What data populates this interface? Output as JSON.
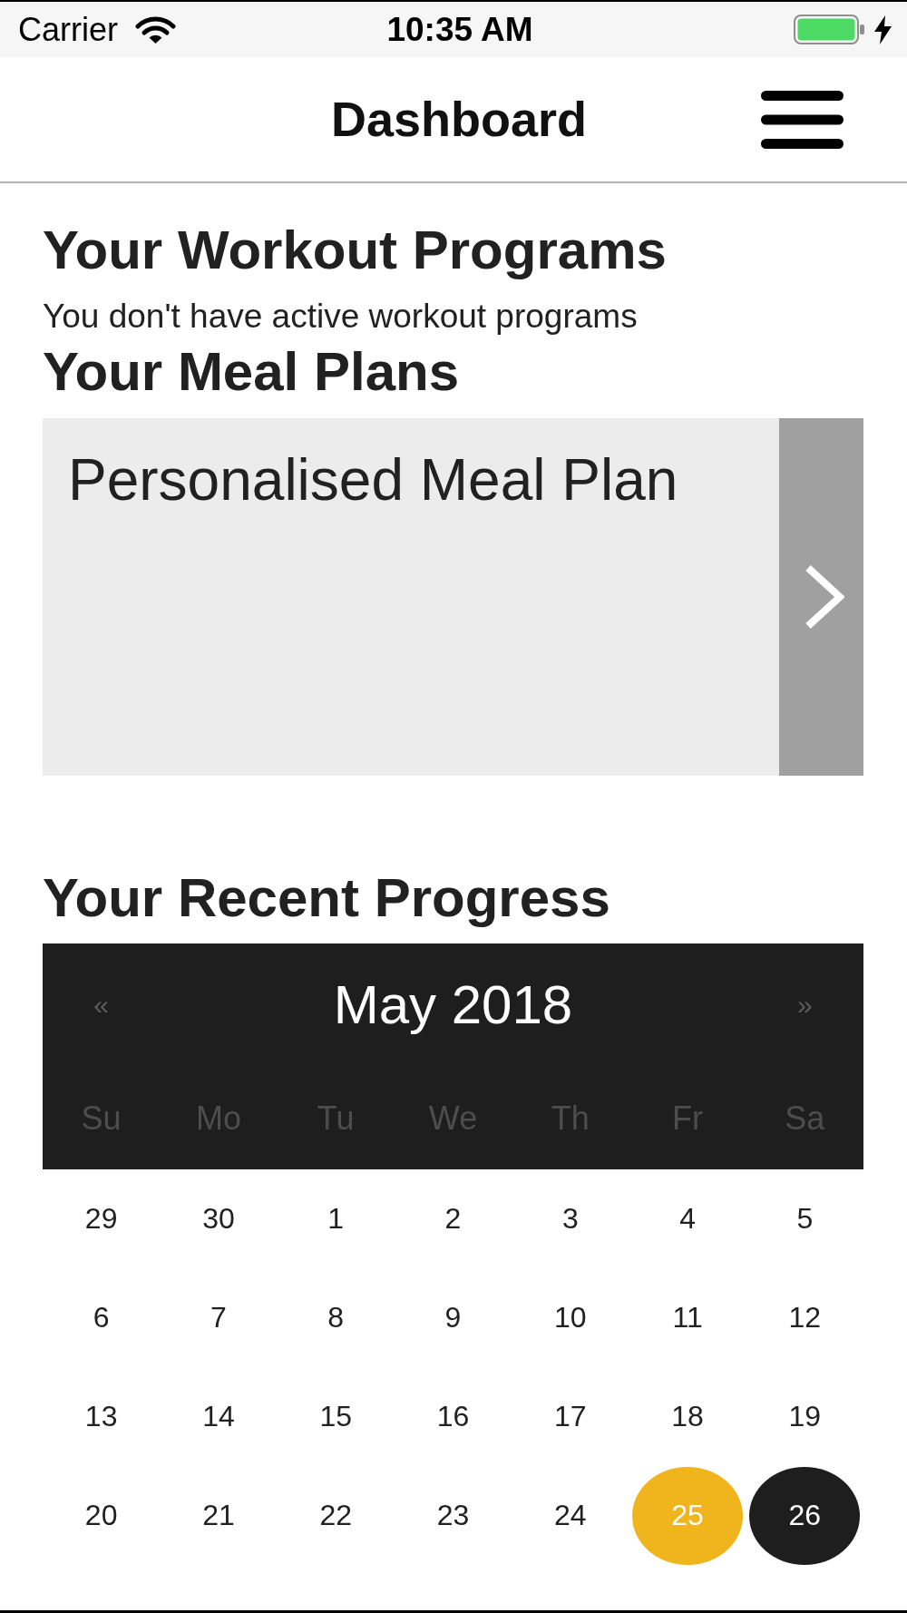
{
  "status_bar": {
    "carrier": "Carrier",
    "time": "10:35 AM"
  },
  "nav_bar": {
    "title": "Dashboard"
  },
  "workout_programs": {
    "heading": "Your Workout Programs",
    "message": "You don't have active workout programs"
  },
  "meal_plans": {
    "heading": "Your Meal Plans",
    "plans": [
      {
        "title": "Personalised Meal Plan"
      }
    ]
  },
  "recent_progress": {
    "heading": "Your Recent Progress",
    "calendar": {
      "previous": "«",
      "month": "May 2018",
      "next": "»",
      "weekdays": [
        "Su",
        "Mo",
        "Tu",
        "We",
        "Th",
        "Fr",
        "Sa"
      ],
      "weeks": [
        [
          {
            "label": "29",
            "today": false,
            "selected": false
          },
          {
            "label": "30",
            "today": false,
            "selected": false
          },
          {
            "label": "1",
            "today": false,
            "selected": false
          },
          {
            "label": "2",
            "today": false,
            "selected": false
          },
          {
            "label": "3",
            "today": false,
            "selected": false
          },
          {
            "label": "4",
            "today": false,
            "selected": false
          },
          {
            "label": "5",
            "today": false,
            "selected": false
          }
        ],
        [
          {
            "label": "6",
            "today": false,
            "selected": false
          },
          {
            "label": "7",
            "today": false,
            "selected": false
          },
          {
            "label": "8",
            "today": false,
            "selected": false
          },
          {
            "label": "9",
            "today": false,
            "selected": false
          },
          {
            "label": "10",
            "today": false,
            "selected": false
          },
          {
            "label": "11",
            "today": false,
            "selected": false
          },
          {
            "label": "12",
            "today": false,
            "selected": false
          }
        ],
        [
          {
            "label": "13",
            "today": false,
            "selected": false
          },
          {
            "label": "14",
            "today": false,
            "selected": false
          },
          {
            "label": "15",
            "today": false,
            "selected": false
          },
          {
            "label": "16",
            "today": false,
            "selected": false
          },
          {
            "label": "17",
            "today": false,
            "selected": false
          },
          {
            "label": "18",
            "today": false,
            "selected": false
          },
          {
            "label": "19",
            "today": false,
            "selected": false
          }
        ],
        [
          {
            "label": "20",
            "today": false,
            "selected": false
          },
          {
            "label": "21",
            "today": false,
            "selected": false
          },
          {
            "label": "22",
            "today": false,
            "selected": false
          },
          {
            "label": "23",
            "today": false,
            "selected": false
          },
          {
            "label": "24",
            "today": false,
            "selected": false
          },
          {
            "label": "25",
            "today": true,
            "selected": false
          },
          {
            "label": "26",
            "today": false,
            "selected": true
          }
        ]
      ]
    }
  }
}
